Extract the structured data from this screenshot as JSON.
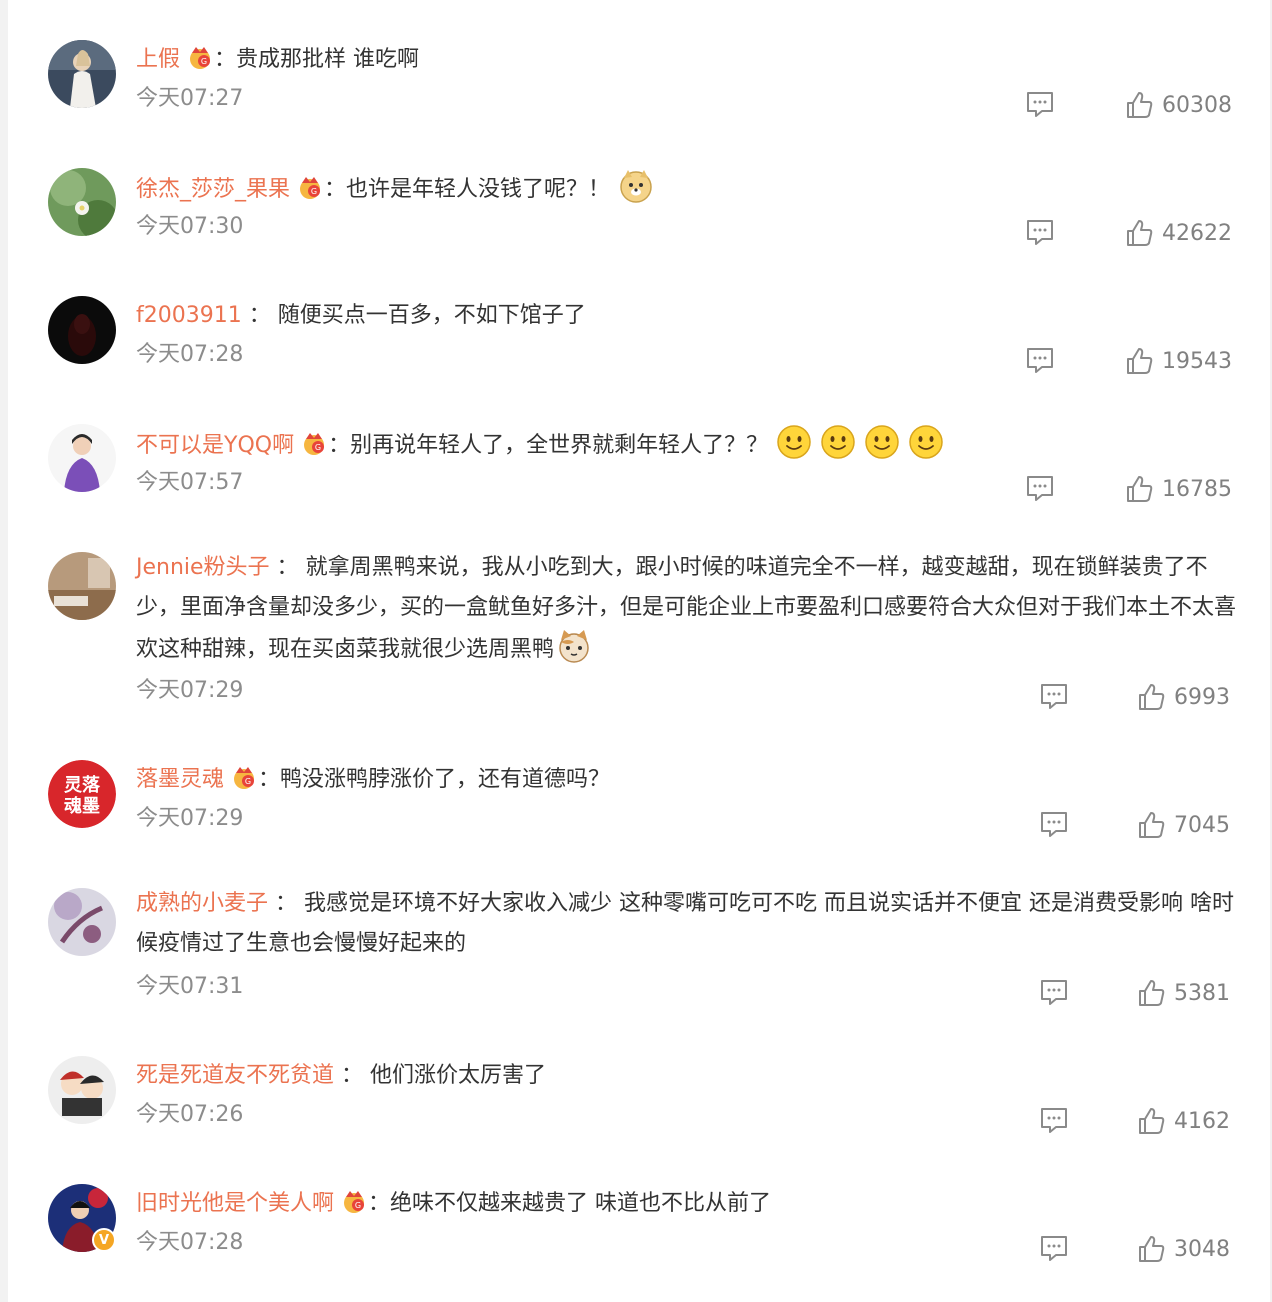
{
  "colors": {
    "username": "#eb7350",
    "text": "#333333",
    "meta": "#8c8c8c"
  },
  "icons": {
    "reply": "comment-icon",
    "like": "thumbs-up-icon",
    "vip": "vip-crown-badge-icon"
  },
  "comments": [
    {
      "user": "上假",
      "sep": "：",
      "text": "贵成那批样 谁吃啊",
      "time": "今天07:27",
      "likes": "60308"
    },
    {
      "user": "徐杰_莎莎_果果",
      "sep": "：",
      "text": "也许是年轻人没钱了呢？！",
      "time": "今天07:30",
      "likes": "42622"
    },
    {
      "user": "f2003911",
      "sep": " ： ",
      "text": "随便买点一百多，不如下馆子了",
      "time": "今天07:28",
      "likes": "19543"
    },
    {
      "user": "不可以是YQQ啊",
      "sep": "：",
      "text": "别再说年轻人了，全世界就剩年轻人了？？",
      "time": "今天07:57",
      "likes": "16785"
    },
    {
      "user": "Jennie粉头子",
      "sep": " ： ",
      "text": "就拿周黑鸭来说，我从小吃到大，跟小时候的味道完全不一样，越变越甜，现在锁鲜装贵了不少，里面净含量却没多少，买的一盒鱿鱼好多汁，但是可能企业上市要盈利口感要符合大众但对于我们本土不太喜欢这种甜辣，现在买卤菜我就很少选周黑鸭",
      "time": "今天07:29",
      "likes": "6993"
    },
    {
      "user": "落墨灵魂",
      "sep": "：",
      "text": "鸭没涨鸭脖涨价了，还有道德吗？",
      "time": "今天07:29",
      "likes": "7045"
    },
    {
      "user": "成熟的小麦子",
      "sep": " ： ",
      "text": "我感觉是环境不好大家收入减少 这种零嘴可吃可不吃 而且说实话并不便宜 还是消费受影响 啥时候疫情过了生意也会慢慢好起来的",
      "time": "今天07:31",
      "likes": "5381"
    },
    {
      "user": "死是死道友不死贫道",
      "sep": " ： ",
      "text": "他们涨价太厉害了",
      "time": "今天07:26",
      "likes": "4162"
    },
    {
      "user": "旧时光他是个美人啊",
      "sep": "：",
      "text": "绝味不仅越来越贵了 味道也不比从前了",
      "time": "今天07:28",
      "likes": "3048"
    }
  ],
  "avatar_text": {
    "c5": "灵落魂墨"
  }
}
